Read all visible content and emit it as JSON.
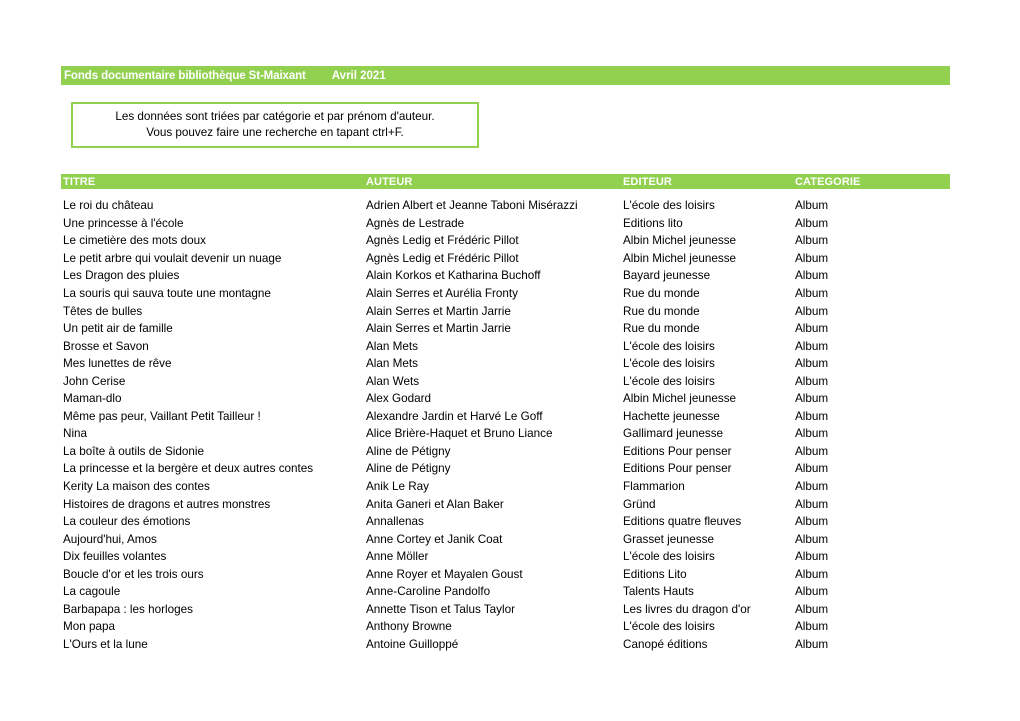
{
  "banner": {
    "title": "Fonds documentaire bibliothèque St-Maixant",
    "date": "Avril 2021",
    "background_color": "#92d050",
    "text_color": "#ffffff"
  },
  "notice": {
    "border_color": "#92d050",
    "line1": "Les données sont triées par catégorie et par prénom d'auteur.",
    "line2": "Vous pouvez faire une recherche en tapant ctrl+F."
  },
  "table": {
    "header_background_color": "#92d050",
    "columns": [
      "TITRE",
      "AUTEUR",
      "EDITEUR",
      "CATEGORIE"
    ],
    "rows": [
      [
        "Le roi du château",
        "Adrien Albert et Jeanne Taboni Misérazzi",
        "L'école des loisirs",
        "Album"
      ],
      [
        "Une princesse à l'école",
        "Agnès de Lestrade",
        "Editions lito",
        "Album"
      ],
      [
        "Le cimetière des mots doux",
        "Agnès Ledig et Frédéric Pillot",
        "Albin Michel jeunesse",
        "Album"
      ],
      [
        "Le petit arbre qui voulait devenir un nuage",
        "Agnès Ledig et Frédéric Pillot",
        "Albin Michel jeunesse",
        "Album"
      ],
      [
        "Les Dragon des pluies",
        "Alain Korkos et Katharina Buchoff",
        "Bayard jeunesse",
        "Album"
      ],
      [
        "La souris qui sauva toute une montagne",
        "Alain Serres et Aurélia Fronty",
        "Rue du monde",
        "Album"
      ],
      [
        "Têtes de bulles",
        "Alain Serres et Martin Jarrie",
        "Rue du monde",
        "Album"
      ],
      [
        "Un petit air de famille",
        "Alain Serres et Martin Jarrie",
        "Rue du monde",
        "Album"
      ],
      [
        "Brosse et Savon",
        "Alan Mets",
        "L'école des loisirs",
        "Album"
      ],
      [
        "Mes lunettes de rêve",
        "Alan Mets",
        "L'école des loisirs",
        "Album"
      ],
      [
        "John Cerise",
        "Alan Wets",
        "L'école des loisirs",
        "Album"
      ],
      [
        "Maman-dlo",
        "Alex Godard",
        "Albin Michel jeunesse",
        "Album"
      ],
      [
        "Même pas peur, Vaillant Petit Tailleur !",
        "Alexandre Jardin et Harvé Le Goff",
        "Hachette jeunesse",
        "Album"
      ],
      [
        "Nina",
        "Alice Brière-Haquet et Bruno Liance",
        "Gallimard jeunesse",
        "Album"
      ],
      [
        "La boîte à outils de Sidonie",
        "Aline de Pétigny",
        "Editions Pour penser",
        "Album"
      ],
      [
        "La princesse et la bergère et deux autres contes",
        "Aline de Pétigny",
        "Editions Pour penser",
        "Album"
      ],
      [
        "Kerity La maison des contes",
        "Anik Le Ray",
        "Flammarion",
        "Album"
      ],
      [
        "Histoires de dragons et autres monstres",
        "Anita Ganeri et Alan Baker",
        "Gründ",
        "Album"
      ],
      [
        "La couleur des émotions",
        "Annallenas",
        "Editions quatre fleuves",
        "Album"
      ],
      [
        "Aujourd'hui, Amos",
        "Anne Cortey et Janik Coat",
        "Grasset jeunesse",
        "Album"
      ],
      [
        "Dix feuilles volantes",
        "Anne Möller",
        "L'école des loisirs",
        "Album"
      ],
      [
        "Boucle d'or et les trois ours",
        "Anne Royer et Mayalen Goust",
        "Editions Lito",
        "Album"
      ],
      [
        "La cagoule",
        "Anne-Caroline Pandolfo",
        "Talents Hauts",
        "Album"
      ],
      [
        "Barbapapa : les horloges",
        "Annette Tison et Talus Taylor",
        "Les livres du dragon d'or",
        "Album"
      ],
      [
        "Mon papa",
        "Anthony Browne",
        "L'école des loisirs",
        "Album"
      ],
      [
        "L'Ours et la lune",
        "Antoine Guilloppé",
        "Canopé éditions",
        "Album"
      ]
    ]
  }
}
